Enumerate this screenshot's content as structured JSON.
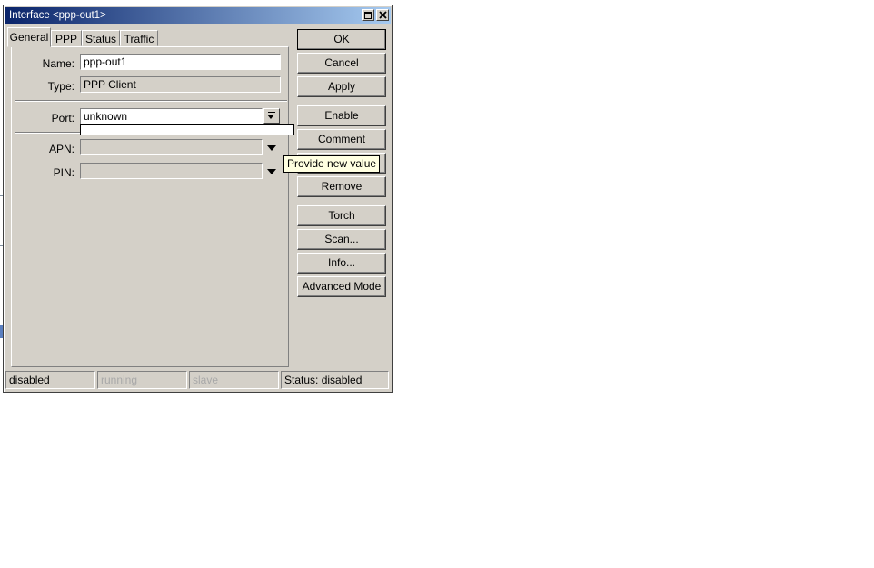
{
  "window": {
    "title": "Interface <ppp-out1>"
  },
  "tabs": [
    {
      "label": "General",
      "active": true
    },
    {
      "label": "PPP"
    },
    {
      "label": "Status"
    },
    {
      "label": "Traffic"
    }
  ],
  "form": {
    "name": {
      "label": "Name:",
      "value": "ppp-out1"
    },
    "type": {
      "label": "Type:",
      "value": "PPP Client"
    },
    "port": {
      "label": "Port:",
      "value": "unknown"
    },
    "apn": {
      "label": "APN:",
      "value": ""
    },
    "pin": {
      "label": "PIN:",
      "value": ""
    }
  },
  "buttons": {
    "ok": "OK",
    "cancel": "Cancel",
    "apply": "Apply",
    "enable": "Enable",
    "comment": "Comment",
    "copy": "",
    "remove": "Remove",
    "torch": "Torch",
    "scan": "Scan...",
    "info": "Info...",
    "advanced": "Advanced Mode"
  },
  "tooltip": "Provide new value",
  "statusbar": {
    "state": "disabled",
    "running": "running",
    "slave": "slave",
    "status": "Status: disabled"
  }
}
